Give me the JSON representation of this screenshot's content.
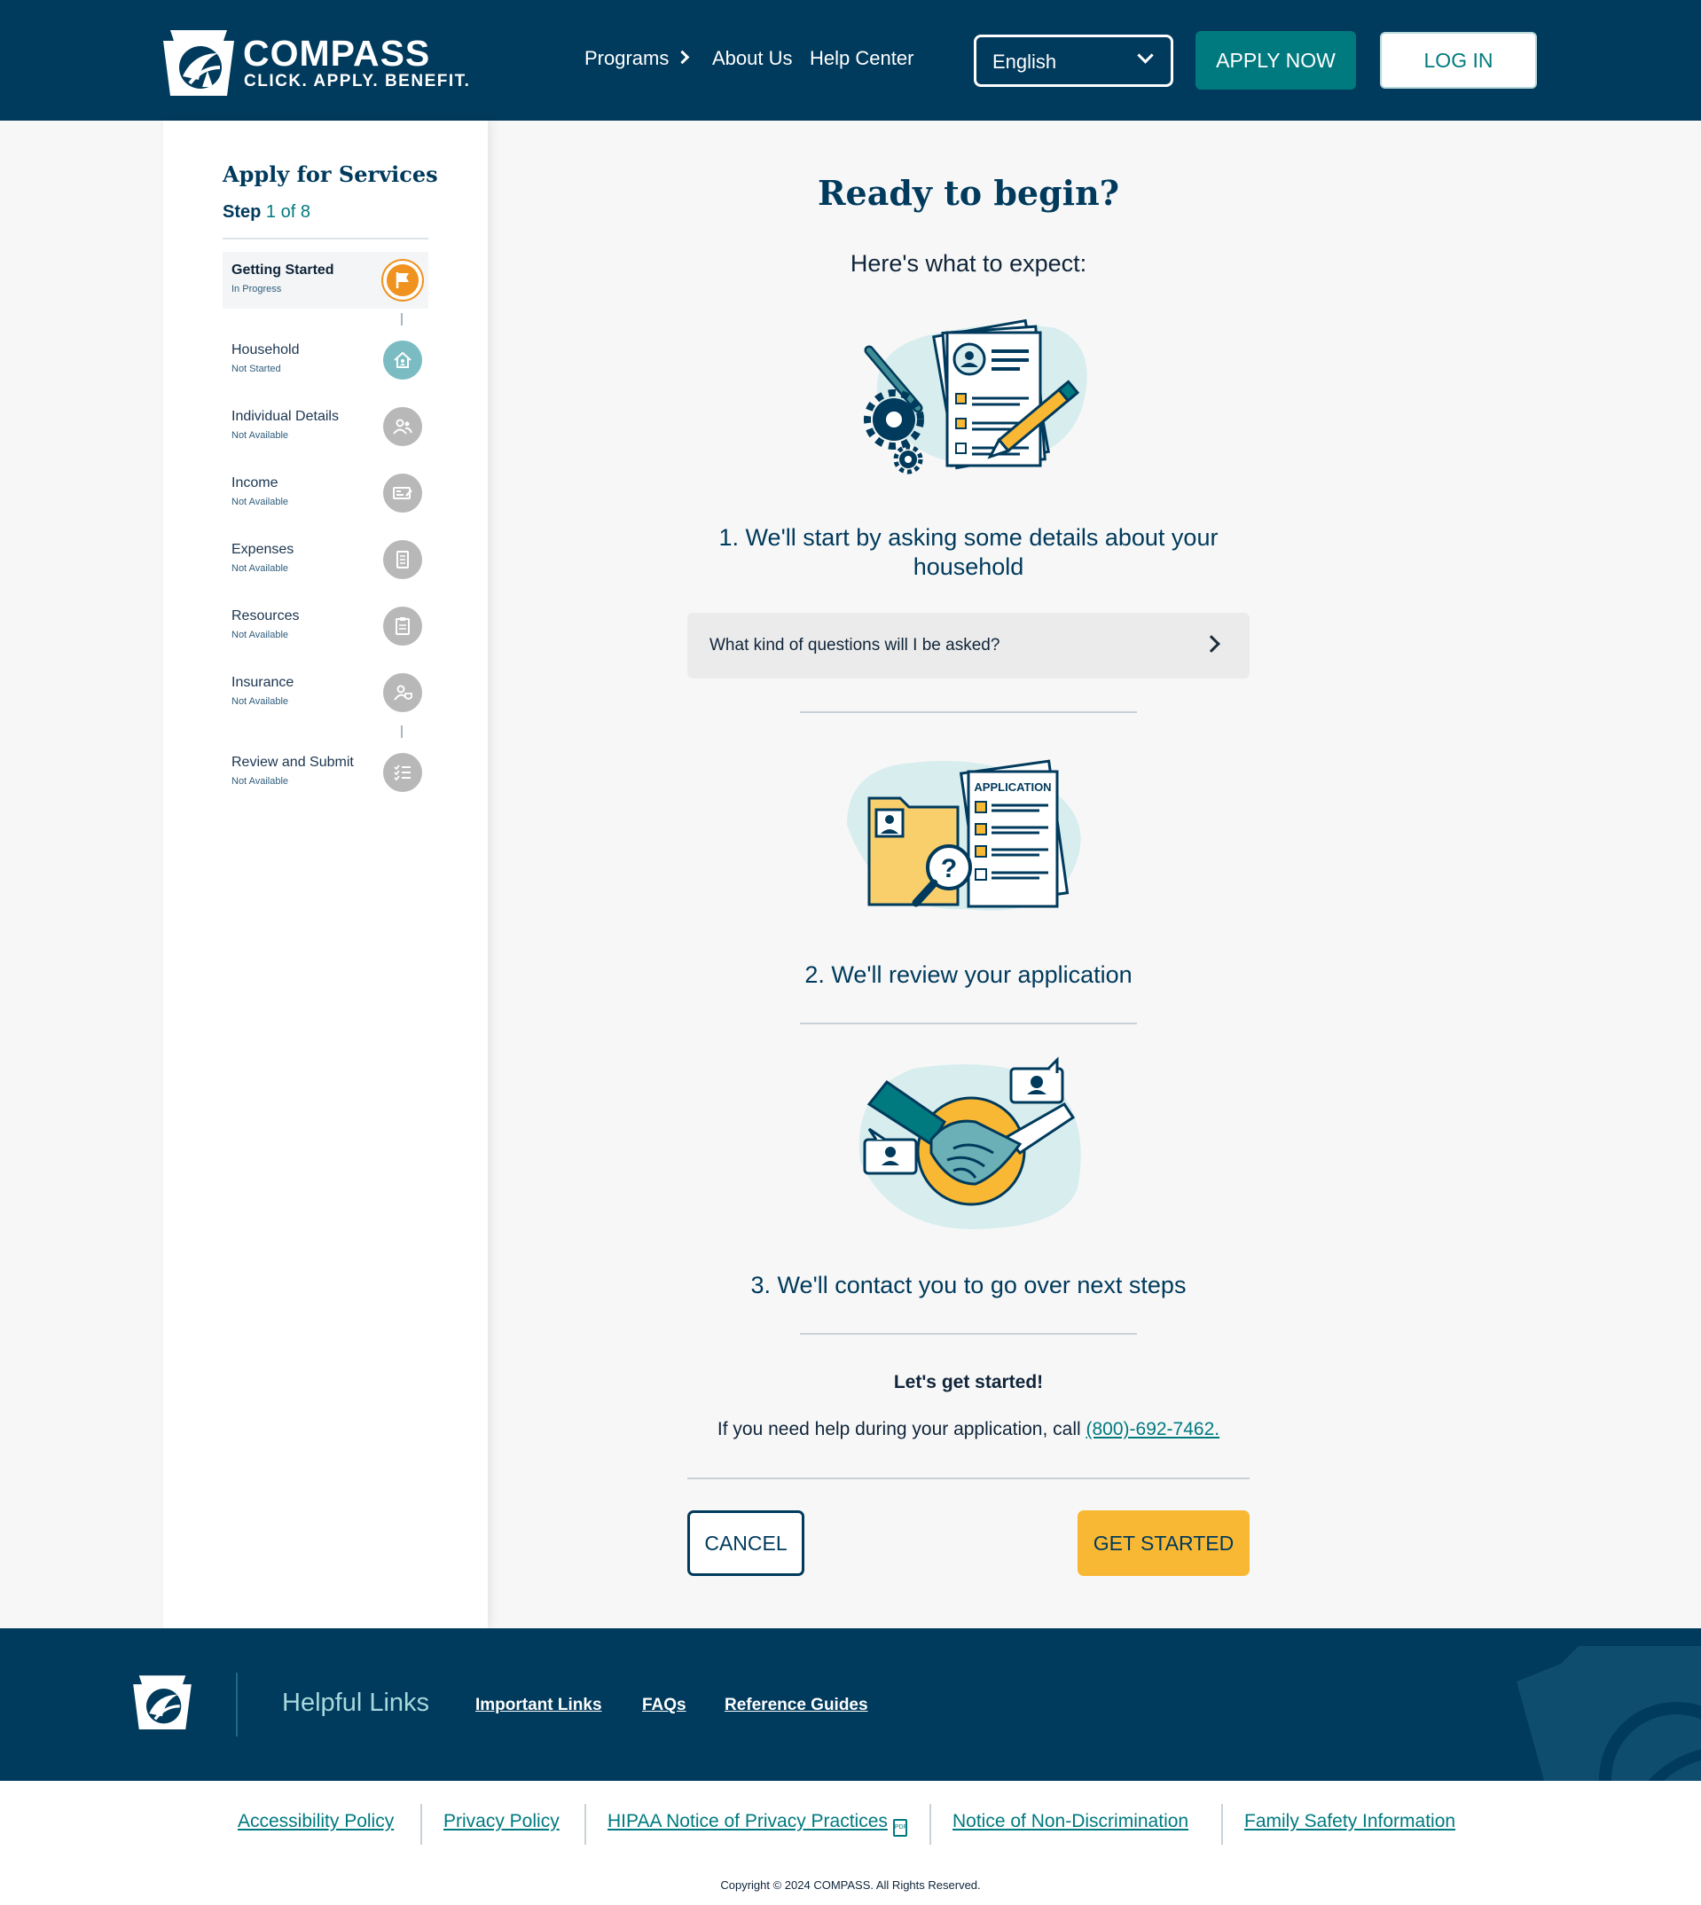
{
  "header": {
    "logo_title": "COMPASS",
    "logo_tagline": "CLICK. APPLY. BENEFIT.",
    "nav": {
      "programs": "Programs",
      "about": "About Us",
      "help": "Help Center"
    },
    "language": "English",
    "apply_label": "APPLY NOW",
    "login_label": "LOG IN"
  },
  "sidebar": {
    "title": "Apply for Services",
    "step_label": "Step",
    "step_progress": "1 of 8",
    "steps": [
      {
        "name": "Getting Started",
        "status": "In Progress",
        "icon": "flag-icon"
      },
      {
        "name": "Household",
        "status": "Not Started",
        "icon": "house-icon"
      },
      {
        "name": "Individual Details",
        "status": "Not Available",
        "icon": "people-icon"
      },
      {
        "name": "Income",
        "status": "Not Available",
        "icon": "check-income-icon"
      },
      {
        "name": "Expenses",
        "status": "Not Available",
        "icon": "receipt-icon"
      },
      {
        "name": "Resources",
        "status": "Not Available",
        "icon": "clipboard-icon"
      },
      {
        "name": "Insurance",
        "status": "Not Available",
        "icon": "insurance-icon"
      },
      {
        "name": "Review and Submit",
        "status": "Not Available",
        "icon": "checklist-icon"
      }
    ]
  },
  "main": {
    "title": "Ready to begin?",
    "subtitle": "Here's what to expect:",
    "item1": "1. We'll start by asking some details about your household",
    "accordion_question": "What kind of questions will I be asked?",
    "item2": "2. We'll review your application",
    "illustration2_label": "APPLICATION",
    "item3": "3. We'll contact you to go over next steps",
    "lets_start": "Let's get started!",
    "help_text": "If you need help during your application, call ",
    "phone": "(800)-692-7462.",
    "cancel_label": "CANCEL",
    "start_label": "GET STARTED"
  },
  "footer": {
    "heading": "Helpful Links",
    "links": [
      "Important Links",
      "FAQs",
      "Reference Guides"
    ],
    "legal_links": [
      "Accessibility Policy",
      "Privacy Policy",
      "HIPAA Notice of Privacy Practices",
      "Notice of Non-Discrimination",
      "Family Safety Information"
    ],
    "pdf_badge": "PDF",
    "copyright": "Copyright © 2024 COMPASS. All Rights Reserved."
  },
  "colors": {
    "navy": "#003a5c",
    "teal": "#007a7f",
    "orange": "#f0921f",
    "yellow": "#f9b833"
  }
}
